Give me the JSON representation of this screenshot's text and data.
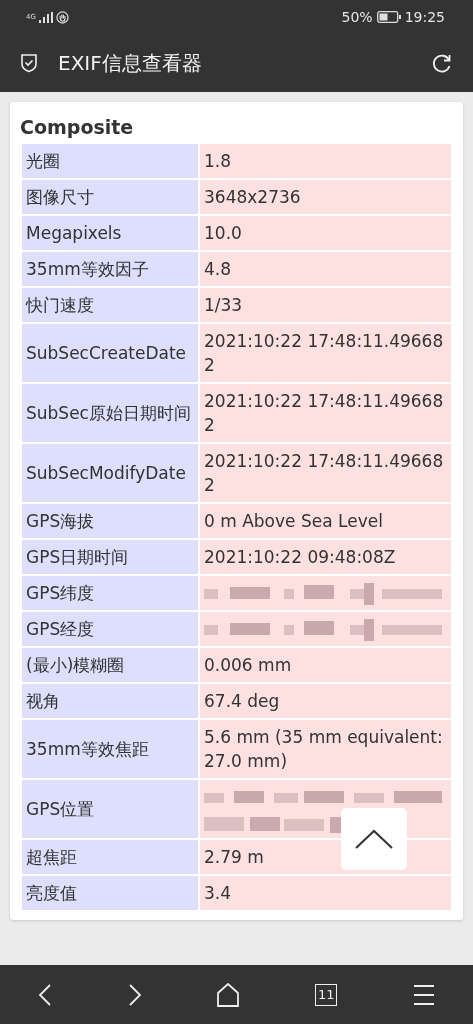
{
  "status_bar": {
    "network": "4G",
    "battery": "50%",
    "time": "19:25"
  },
  "app_bar": {
    "title": "EXIF信息查看器"
  },
  "section": {
    "title": "Composite"
  },
  "rows": [
    {
      "label": "光圈",
      "kind": "text",
      "value": "1.8"
    },
    {
      "label": "图像尺寸",
      "kind": "text",
      "value": "3648x2736"
    },
    {
      "label": "Megapixels",
      "kind": "text",
      "value": "10.0"
    },
    {
      "label": "35mm等效因子",
      "kind": "text",
      "value": "4.8"
    },
    {
      "label": "快门速度",
      "kind": "text",
      "value": "1/33"
    },
    {
      "label": "SubSecCreateDate",
      "kind": "text",
      "value": "2021:10:22 17:48:11.496682"
    },
    {
      "label": "SubSec原始日期时间",
      "kind": "text",
      "value": "2021:10:22 17:48:11.496682"
    },
    {
      "label": "SubSecModifyDate",
      "kind": "text",
      "value": "2021:10:22 17:48:11.496682"
    },
    {
      "label": "GPS海拔",
      "kind": "text",
      "value": "0 m Above Sea Level"
    },
    {
      "label": "GPS日期时间",
      "kind": "text",
      "value": "2021:10:22 09:48:08Z"
    },
    {
      "label": "GPS纬度",
      "kind": "redacted"
    },
    {
      "label": "GPS经度",
      "kind": "redacted"
    },
    {
      "label": "(最小)模糊圈",
      "kind": "text",
      "value": "0.006 mm"
    },
    {
      "label": "视角",
      "kind": "text",
      "value": "67.4 deg"
    },
    {
      "label": "35mm等效焦距",
      "kind": "text",
      "value": "5.6 mm (35 mm equivalent: 27.0 mm)"
    },
    {
      "label": "GPS位置",
      "kind": "redacted_tall"
    },
    {
      "label": "超焦距",
      "kind": "text",
      "value": "2.79 m"
    },
    {
      "label": "亮度值",
      "kind": "text",
      "value": "3.4"
    }
  ],
  "bottom_nav": {
    "tabs_count": "11"
  }
}
